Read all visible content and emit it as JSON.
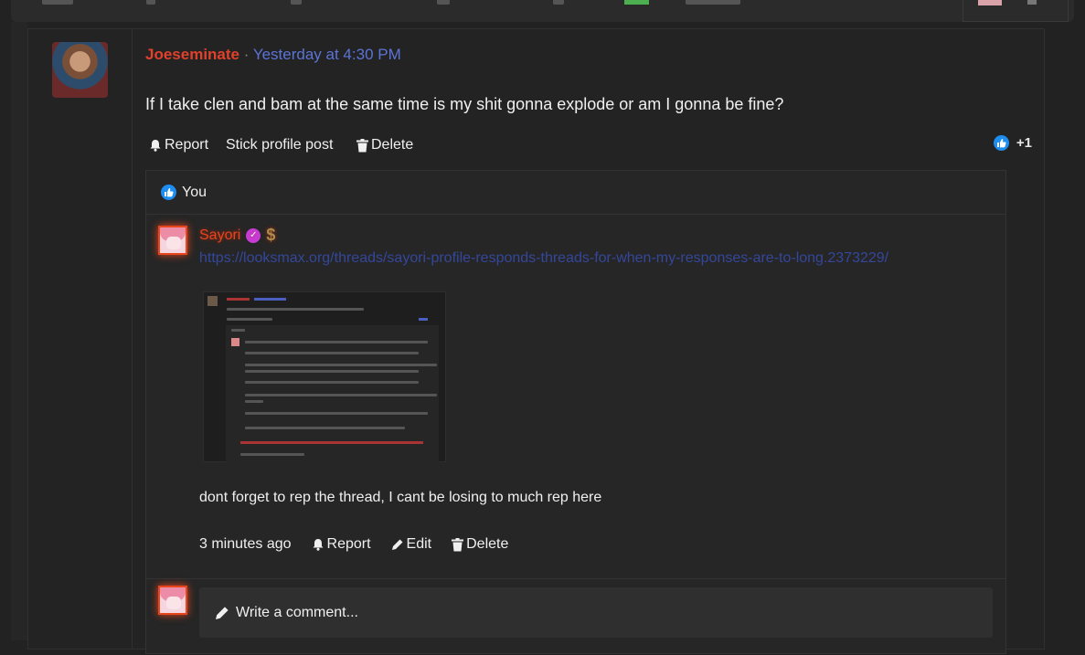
{
  "post": {
    "author": "Joeseminate",
    "separator": "·",
    "timestamp": "Yesterday at 4:30 PM",
    "message": "If I take clen and bam at the same time is my shit gonna explode or am I gonna be fine?",
    "actions": {
      "report": "Report",
      "stick": "Stick profile post",
      "delete": "Delete"
    },
    "like_count": "+1"
  },
  "likes": {
    "label": "You"
  },
  "comment": {
    "username": "Sayori",
    "link": "https://looksmax.org/threads/sayori-profile-responds-threads-for-when-my-responses-are-to-long.2373229/",
    "text": "dont forget to rep the thread, I cant be losing to much rep here",
    "time": "3 minutes ago",
    "report": "Report",
    "edit": "Edit",
    "delete": "Delete",
    "badge_icon": "verified-icon",
    "currency_icon": "dollar-icon"
  },
  "composer": {
    "placeholder": "Write a comment..."
  },
  "colors": {
    "author": "#e0412b",
    "timestamp": "#5b74d6",
    "link": "#34479a",
    "like": "#1d8df0",
    "badge": "#c93bd6"
  }
}
